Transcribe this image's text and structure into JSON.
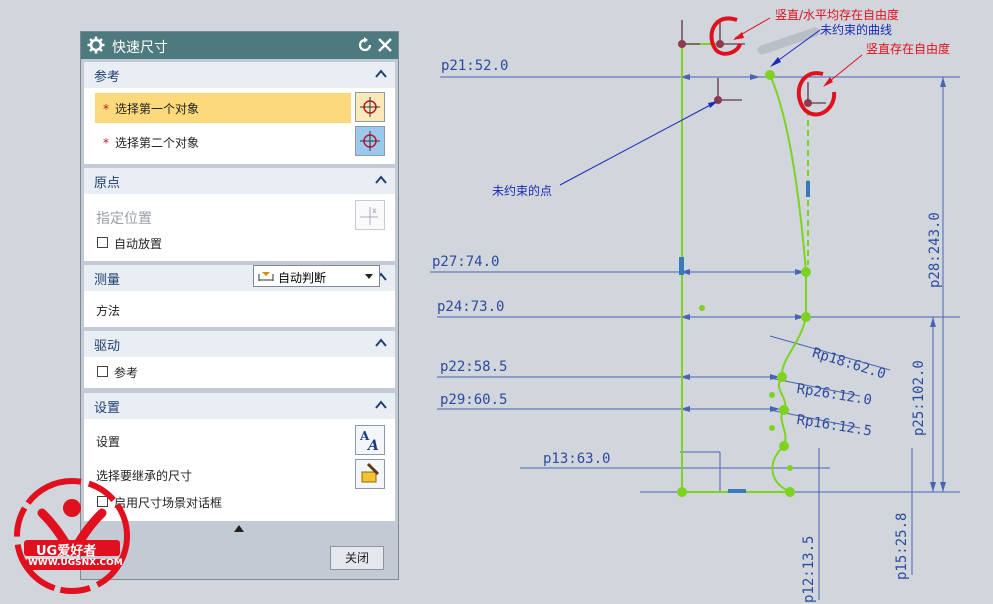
{
  "dialog": {
    "title": "快速尺寸",
    "reference": {
      "header": "参考",
      "first_object": "选择第一个对象",
      "second_object": "选择第二个对象",
      "required_mark": "*"
    },
    "origin": {
      "header": "原点",
      "specify_location": "指定位置",
      "auto_place": "自动放置"
    },
    "measure": {
      "header": "测量",
      "method_label": "方法",
      "method_value": "自动判断"
    },
    "drive": {
      "header": "驱动",
      "reference": "参考"
    },
    "settings": {
      "header": "设置",
      "settings_label": "设置",
      "inherit_label": "选择要继承的尺寸",
      "enable_dialog": "启用尺寸场景对话框"
    },
    "close_button": "关闭"
  },
  "dimensions": {
    "p21": "p21:52.0",
    "p27": "p27:74.0",
    "p24": "p24:73.0",
    "p22": "p22:58.5",
    "p29": "p29:60.5",
    "p13": "p13:63.0",
    "p18": "Rp18:62.0",
    "p26": "Rp26:12.0",
    "p16": "Rp16:12.5",
    "p28": "p28:243.0",
    "p25": "p25:102.0",
    "p15": "p15:25.8",
    "p12": "p12:13.5"
  },
  "annotations": {
    "both_free": "竖直/水平均存在自由度",
    "unconstrained_curve": "未约束的曲线",
    "vertical_free": "竖直存在自由度",
    "unconstrained_point": "未约束的点"
  },
  "watermark": {
    "brand": "UG爱好者",
    "url": "WWW.UGSNX.COM"
  },
  "colors": {
    "dimension_blue": "#2e4aa0",
    "geometry_green": "#7ed321",
    "annotation_red": "#e0101e",
    "titlebar": "#4c7a7e",
    "selected_row": "#fcd97a"
  }
}
